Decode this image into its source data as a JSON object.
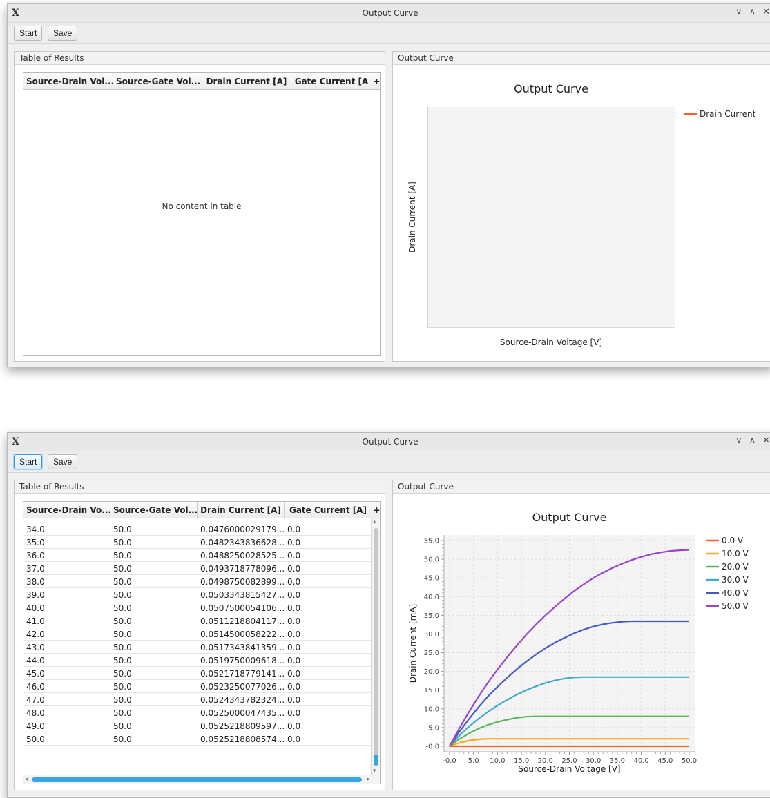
{
  "windows": [
    {
      "title": "Output Curve",
      "toolbar": {
        "start_label": "Start",
        "save_label": "Save"
      },
      "table_panel": {
        "title": "Table of Results",
        "columns": [
          "Source-Drain Vol...",
          "Source-Gate Vol...",
          "Drain Current [A]",
          "Gate Current [A",
          "+"
        ],
        "empty_message": "No content in table"
      },
      "chart_panel": {
        "title": "Output Curve"
      }
    },
    {
      "title": "Output Curve",
      "toolbar": {
        "start_label": "Start",
        "save_label": "Save"
      },
      "table_panel": {
        "title": "Table of Results",
        "columns": [
          "Source-Drain Vo...",
          "Source-Gate Vol...",
          "Drain Current [A]",
          "Gate Current [A]",
          "+"
        ],
        "rows": [
          [
            "34.0",
            "50.0",
            "0.0476000029179...",
            "0.0"
          ],
          [
            "35.0",
            "50.0",
            "0.0482343836628...",
            "0.0"
          ],
          [
            "36.0",
            "50.0",
            "0.0488250028525...",
            "0.0"
          ],
          [
            "37.0",
            "50.0",
            "0.0493718778096...",
            "0.0"
          ],
          [
            "38.0",
            "50.0",
            "0.0498750082899...",
            "0.0"
          ],
          [
            "39.0",
            "50.0",
            "0.0503343815427...",
            "0.0"
          ],
          [
            "40.0",
            "50.0",
            "0.0507500054106...",
            "0.0"
          ],
          [
            "41.0",
            "50.0",
            "0.0511218804117...",
            "0.0"
          ],
          [
            "42.0",
            "50.0",
            "0.0514500058222...",
            "0.0"
          ],
          [
            "43.0",
            "50.0",
            "0.0517343841359...",
            "0.0"
          ],
          [
            "44.0",
            "50.0",
            "0.0519750009618...",
            "0.0"
          ],
          [
            "45.0",
            "50.0",
            "0.0521718779141...",
            "0.0"
          ],
          [
            "46.0",
            "50.0",
            "0.0523250077026...",
            "0.0"
          ],
          [
            "47.0",
            "50.0",
            "0.0524343782324...",
            "0.0"
          ],
          [
            "48.0",
            "50.0",
            "0.0525000047435...",
            "0.0"
          ],
          [
            "49.0",
            "50.0",
            "0.0525218809597...",
            "0.0"
          ],
          [
            "50.0",
            "50.0",
            "0.0525218808574...",
            "0.0"
          ]
        ]
      },
      "chart_panel": {
        "title": "Output Curve"
      }
    }
  ],
  "chart_data": [
    {
      "type": "line",
      "title": "Output Curve",
      "xlabel": "Source-Drain Voltage [V]",
      "ylabel": "Drain Current [A]",
      "grid": false,
      "legend_position": "right",
      "series": [
        {
          "name": "Drain Current",
          "color": "#f3622d",
          "x": [],
          "y": []
        }
      ]
    },
    {
      "type": "line",
      "title": "Output Curve",
      "xlabel": "Source-Drain Voltage [V]",
      "ylabel": "Drain Current [mA]",
      "xlim": [
        0,
        50
      ],
      "ylim": [
        0,
        55
      ],
      "x_ticks": [
        "-0.0",
        "5.0",
        "10.0",
        "15.0",
        "20.0",
        "25.0",
        "30.0",
        "35.0",
        "40.0",
        "45.0",
        "50.0"
      ],
      "y_ticks": [
        "-0.0",
        "5.0",
        "10.0",
        "15.0",
        "20.0",
        "25.0",
        "30.0",
        "35.0",
        "40.0",
        "45.0",
        "50.0",
        "55.0"
      ],
      "grid": true,
      "legend_position": "right",
      "series": [
        {
          "name": "0.0 V",
          "color": "#f3622d",
          "x": [
            0,
            5,
            10,
            15,
            20,
            25,
            30,
            35,
            40,
            45,
            50
          ],
          "y": [
            0,
            0,
            0,
            0,
            0,
            0,
            0,
            0,
            0,
            0,
            0
          ]
        },
        {
          "name": "10.0 V",
          "color": "#fba71b",
          "x": [
            0,
            2,
            4,
            6,
            8,
            10,
            15,
            20,
            25,
            30,
            35,
            40,
            45,
            50
          ],
          "y": [
            0,
            0.9,
            1.5,
            1.85,
            2.0,
            2.0,
            2.0,
            2.0,
            2.0,
            2.0,
            2.0,
            2.0,
            2.0,
            2.0
          ]
        },
        {
          "name": "20.0 V",
          "color": "#57b757",
          "x": [
            0,
            2,
            4,
            6,
            8,
            10,
            12,
            14,
            16,
            18,
            20,
            25,
            30,
            35,
            40,
            45,
            50
          ],
          "y": [
            0,
            1.9,
            3.4,
            4.7,
            5.7,
            6.5,
            7.1,
            7.6,
            7.9,
            8.0,
            8.0,
            8.0,
            8.0,
            8.0,
            8.0,
            8.0,
            8.0
          ]
        },
        {
          "name": "30.0 V",
          "color": "#41a9c9",
          "x": [
            0,
            2,
            4,
            6,
            8,
            10,
            12,
            14,
            16,
            18,
            20,
            22,
            24,
            26,
            28,
            30,
            35,
            40,
            45,
            50
          ],
          "y": [
            0,
            2.8,
            5.2,
            7.3,
            9.2,
            10.9,
            12.4,
            13.8,
            15.0,
            16.0,
            16.9,
            17.6,
            18.1,
            18.4,
            18.5,
            18.5,
            18.5,
            18.5,
            18.5,
            18.5
          ]
        },
        {
          "name": "40.0 V",
          "color": "#4258c9",
          "x": [
            0,
            2,
            4,
            6,
            8,
            10,
            12,
            14,
            16,
            18,
            20,
            22,
            24,
            26,
            28,
            30,
            32,
            34,
            36,
            38,
            40,
            45,
            50
          ],
          "y": [
            0,
            3.8,
            7.2,
            10.4,
            13.3,
            15.9,
            18.3,
            20.6,
            22.6,
            24.5,
            26.2,
            27.7,
            29.0,
            30.2,
            31.2,
            32.0,
            32.6,
            33.0,
            33.3,
            33.4,
            33.4,
            33.4,
            33.4
          ]
        },
        {
          "name": "50.0 V",
          "color": "#9a42c8",
          "x": [
            0,
            2,
            4,
            6,
            8,
            10,
            12,
            14,
            16,
            18,
            20,
            22,
            24,
            26,
            28,
            30,
            32,
            34,
            36,
            38,
            40,
            42,
            44,
            46,
            48,
            50
          ],
          "y": [
            0,
            4.7,
            9.1,
            13.2,
            17.0,
            20.5,
            23.8,
            26.9,
            29.8,
            32.5,
            35.0,
            37.3,
            39.5,
            41.5,
            43.3,
            45.0,
            46.4,
            47.7,
            48.8,
            49.8,
            50.6,
            51.3,
            51.8,
            52.2,
            52.4,
            52.5
          ]
        }
      ]
    }
  ]
}
